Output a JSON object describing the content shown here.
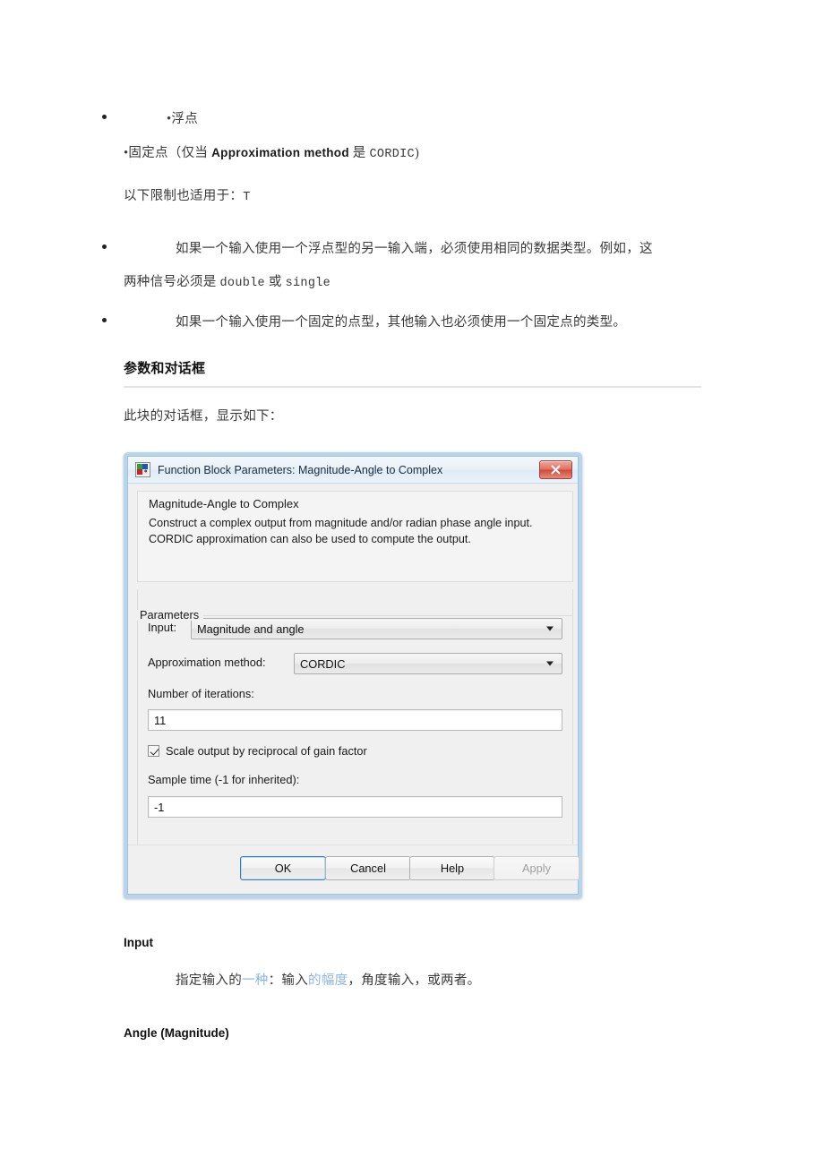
{
  "document": {
    "bullets_top": [
      {
        "marker": "•",
        "text": "浮点"
      },
      {
        "marker": "•",
        "text_prefix": "固定点（仅当 ",
        "bold": "Approximation method",
        "text_mid": " 是 ",
        "mono": "CORDIC",
        "text_suffix": ")"
      }
    ],
    "note_line": {
      "text": "以下限制也适用于：",
      "mono": "T"
    },
    "bullets_mid": [
      {
        "line1": "如果一个输入使用一个浮点型的另一输入端，必须使用相同的数据类型。例如，这",
        "line2_prefix": "两种信号必须是 ",
        "line2_mono1": "double",
        "line2_mid": " 或 ",
        "line2_mono2": "single"
      },
      {
        "line1": "如果一个输入使用一个固定的点型，其他输入也必须使用一个固定点的类型。"
      }
    ],
    "section_heading": "参数和对话框",
    "intro_text": "此块的对话框，显示如下：",
    "after_dialog": {
      "heading_input": "Input",
      "input_desc_a": "指定输入的",
      "input_desc_b": "一种",
      "input_desc_c": "：输入",
      "input_desc_d": "的幅度",
      "input_desc_e": "，角度输入，或两者。",
      "heading_angle": "Angle (Magnitude)"
    }
  },
  "dialog": {
    "titlebar": {
      "title": "Function Block Parameters: Magnitude-Angle to Complex",
      "close_label": "✕",
      "icon": "simulink-block-icon"
    },
    "description": {
      "heading": "Magnitude-Angle to Complex",
      "body": "Construct a complex output from magnitude and/or radian phase angle input. CORDIC approximation can also be used to compute the output."
    },
    "parameters": {
      "legend": "Parameters",
      "input_label": "Input:",
      "input_value": "Magnitude and angle",
      "approx_label": "Approximation method:",
      "approx_value": "CORDIC",
      "iterations_label": "Number of iterations:",
      "iterations_value": "11",
      "scale_checkbox_label": "Scale output by reciprocal of gain factor",
      "scale_checkbox_checked": true,
      "sample_time_label": "Sample time (-1 for inherited):",
      "sample_time_value": "-1"
    },
    "buttons": {
      "ok": "OK",
      "cancel": "Cancel",
      "help": "Help",
      "apply": "Apply",
      "apply_disabled": true
    },
    "colors": {
      "border": "#b7d5ec",
      "face": "#f0f0f0",
      "close_red": "#cf4a38",
      "focus_blue": "#3c7fb1"
    }
  }
}
